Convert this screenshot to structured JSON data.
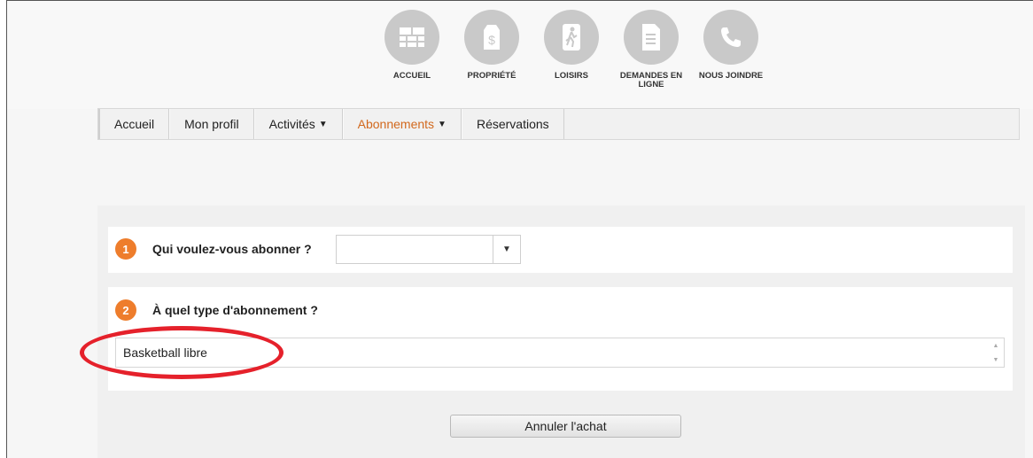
{
  "top_nav": [
    {
      "label": "ACCUEIL",
      "icon": "storefront-icon"
    },
    {
      "label": "PROPRIÉTÉ",
      "icon": "price-tag-icon"
    },
    {
      "label": "LOISIRS",
      "icon": "running-person-icon"
    },
    {
      "label": "DEMANDES EN LIGNE",
      "icon": "document-icon"
    },
    {
      "label": "NOUS JOINDRE",
      "icon": "phone-icon"
    }
  ],
  "menu": [
    {
      "label": "Accueil"
    },
    {
      "label": "Mon profil"
    },
    {
      "label": "Activités",
      "caret": "▼"
    },
    {
      "label": "Abonnements",
      "caret": "▼",
      "active": true
    },
    {
      "label": "Réservations"
    }
  ],
  "step1": {
    "number": "1",
    "question": "Qui voulez-vous abonner ?",
    "select_value": "",
    "arrow": "▼"
  },
  "step2": {
    "number": "2",
    "question": "À quel type d'abonnement ?",
    "option": "Basketball libre"
  },
  "cancel_button": "Annuler l'achat",
  "colors": {
    "accent": "#ee7d2c",
    "active_menu": "#d2691e",
    "annotation": "#e5212b",
    "icon_circle": "#c9c9c9"
  }
}
